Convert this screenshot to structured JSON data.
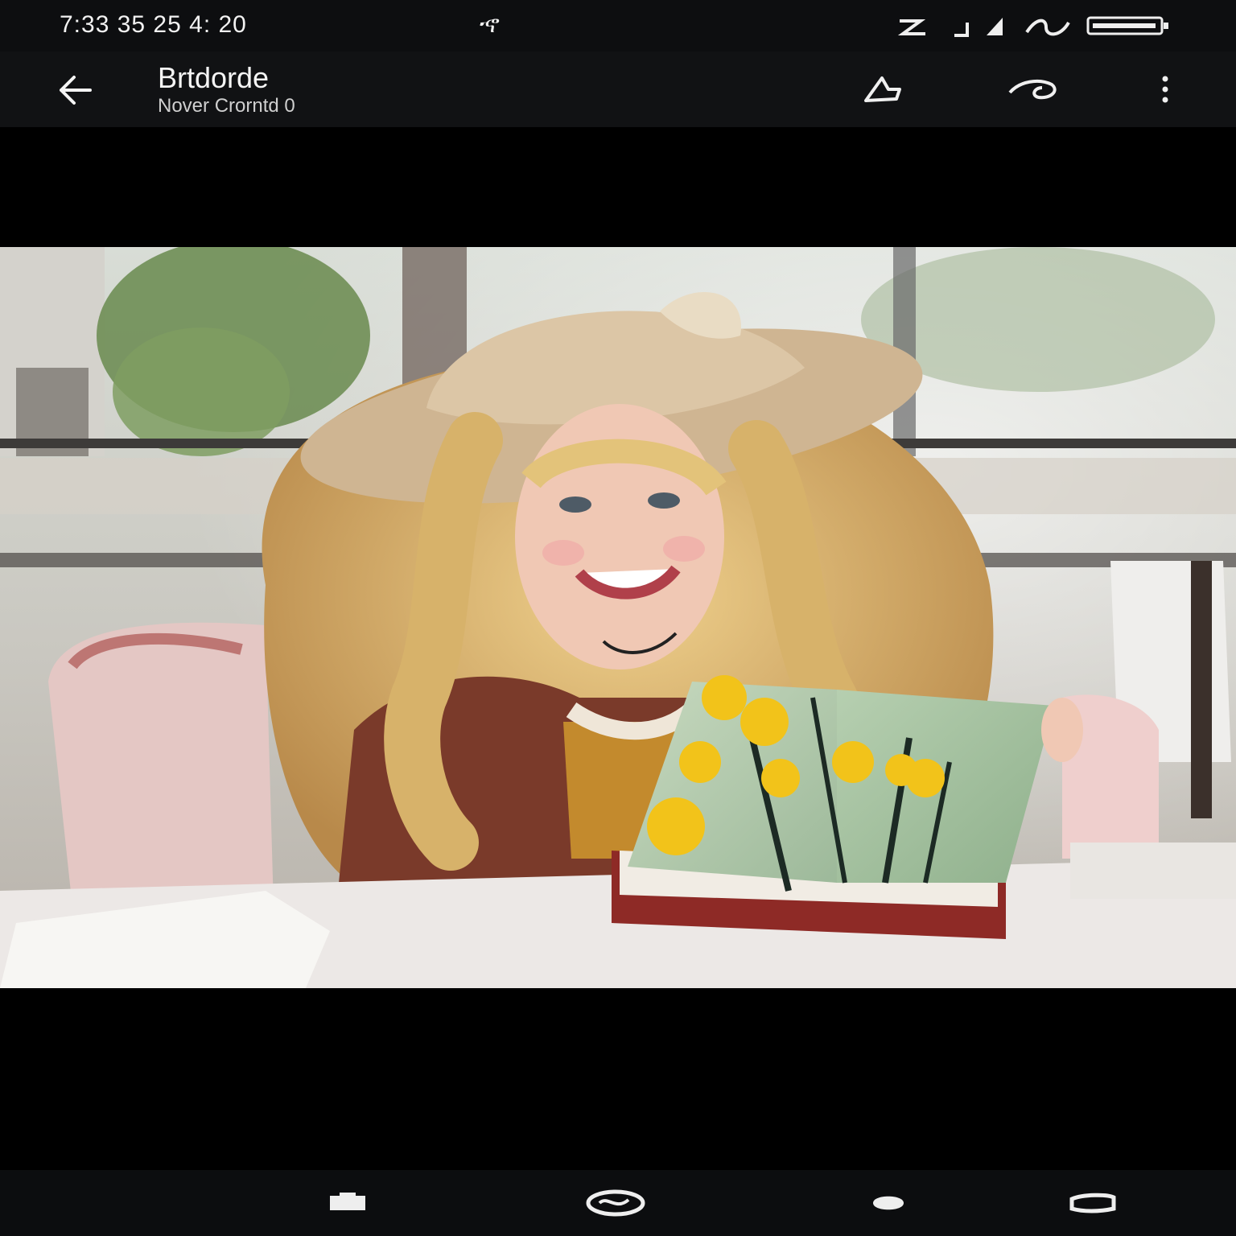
{
  "status_bar": {
    "time_text": "7:33  35   25   4:   20",
    "notification_text": "ኆ"
  },
  "header": {
    "title": "Brtdorde",
    "subtitle": "Nover Crorntd 0"
  },
  "photo": {
    "description_colors": {
      "sky": "#e9ece6",
      "foliage": "#6f8e55",
      "hat": "#d9c3a0",
      "hair": "#e3c37a",
      "skin": "#f0c8b4",
      "dress": "#7a3a2a",
      "book_page": "#a7c4a4",
      "flower": "#f2c31a",
      "table": "#ece8e6",
      "chair": "#d7a6a6"
    }
  },
  "icons": {
    "back": "back-arrow-icon",
    "share": "share-icon",
    "edit": "edit-icon",
    "more": "more-vert-icon",
    "nav_recents": "recents-icon",
    "nav_home": "home-icon",
    "nav_back": "back-nav-icon",
    "nav_keyboard": "keyboard-icon"
  }
}
